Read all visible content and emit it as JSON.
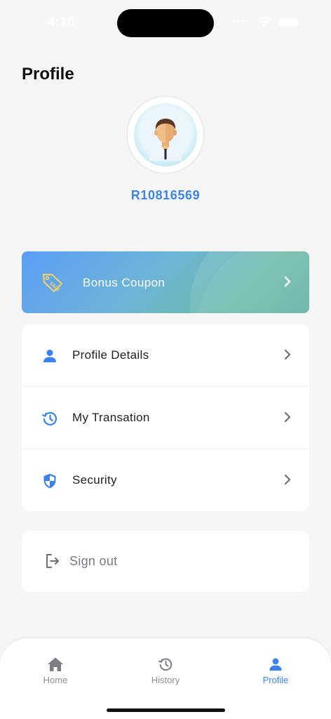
{
  "status_bar": {
    "time": "4:10"
  },
  "header": {
    "title": "Profile"
  },
  "profile": {
    "user_id": "R10816569"
  },
  "coupon": {
    "label": "Bonus Coupon",
    "icon": "sale-tag-icon"
  },
  "menu": {
    "items": [
      {
        "label": "Profile Details",
        "icon": "person-icon"
      },
      {
        "label": "My Transation",
        "icon": "history-icon"
      },
      {
        "label": "Security",
        "icon": "shield-icon"
      }
    ]
  },
  "sign_out": {
    "label": "Sign out",
    "icon": "logout-icon"
  },
  "tab_bar": {
    "tabs": [
      {
        "label": "Home",
        "icon": "home-icon",
        "active": false
      },
      {
        "label": "History",
        "icon": "history-icon",
        "active": false
      },
      {
        "label": "Profile",
        "icon": "person-icon",
        "active": true
      }
    ]
  },
  "colors": {
    "accent": "#3b82f0",
    "user_id": "#3c85e6",
    "background": "#f6f6f7",
    "inactive_tab": "#8e8e93"
  }
}
